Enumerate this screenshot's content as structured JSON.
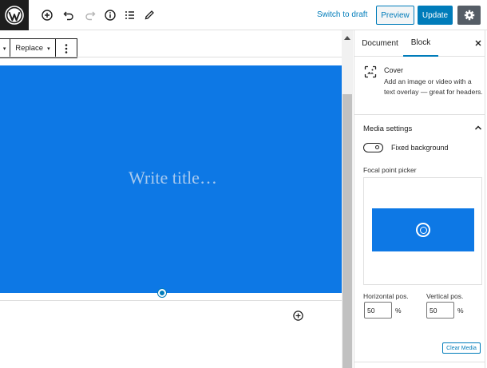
{
  "toolbar": {
    "switch_to_draft": "Switch to draft",
    "preview": "Preview",
    "update": "Update"
  },
  "block_toolbar": {
    "replace": "Replace"
  },
  "cover": {
    "title_placeholder": "Write title…",
    "background_color": "#0d78e5"
  },
  "sidebar": {
    "tabs": [
      {
        "label": "Document",
        "active": false
      },
      {
        "label": "Block",
        "active": true
      }
    ],
    "block": {
      "name": "Cover",
      "description": "Add an image or video with a text overlay — great for headers."
    },
    "media_settings": {
      "title": "Media settings",
      "fixed_background_label": "Fixed background",
      "fixed_background_on": false,
      "focal_point_label": "Focal point picker",
      "horizontal_label": "Horizontal pos.",
      "horizontal_value": "50",
      "vertical_label": "Vertical pos.",
      "vertical_value": "50",
      "unit": "%",
      "clear_media": "Clear Media"
    }
  },
  "colors": {
    "accent": "#007cba",
    "dark": "#1e1e1e",
    "settings_button": "#555d66"
  }
}
